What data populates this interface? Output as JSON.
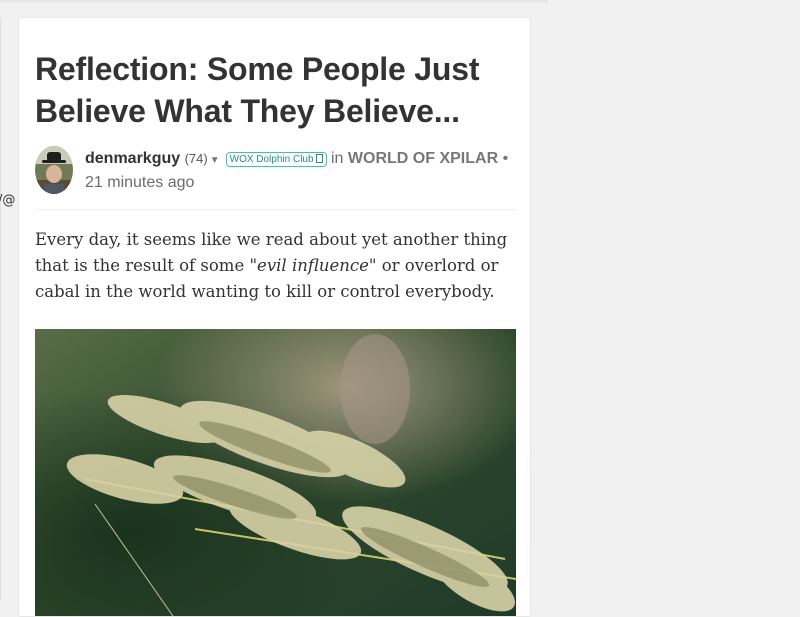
{
  "sidebar": {
    "fragment_text": "/@"
  },
  "post": {
    "title": "Reflection: Some People Just Believe What They Believe...",
    "author": {
      "name": "denmarkguy",
      "reputation": "(74)"
    },
    "badge": {
      "label": "WOX Dolphin Club"
    },
    "in_label": "in",
    "community": "WORLD OF XPILAR",
    "separator": "•",
    "timestamp": "21 minutes ago",
    "body": {
      "part1": "Every day, it seems like we read about yet another thing that is the result of some ",
      "emphasis": "\"evil influence\"",
      "part2": " or overlord or cabal in the world wanting to kill or control everybody."
    }
  },
  "colors": {
    "badge_border": "#36c5b5",
    "title_text": "#333333",
    "meta_text": "#6c6c6c"
  },
  "icons": {
    "caret": "chevron-down-icon",
    "badge": "box-icon"
  }
}
